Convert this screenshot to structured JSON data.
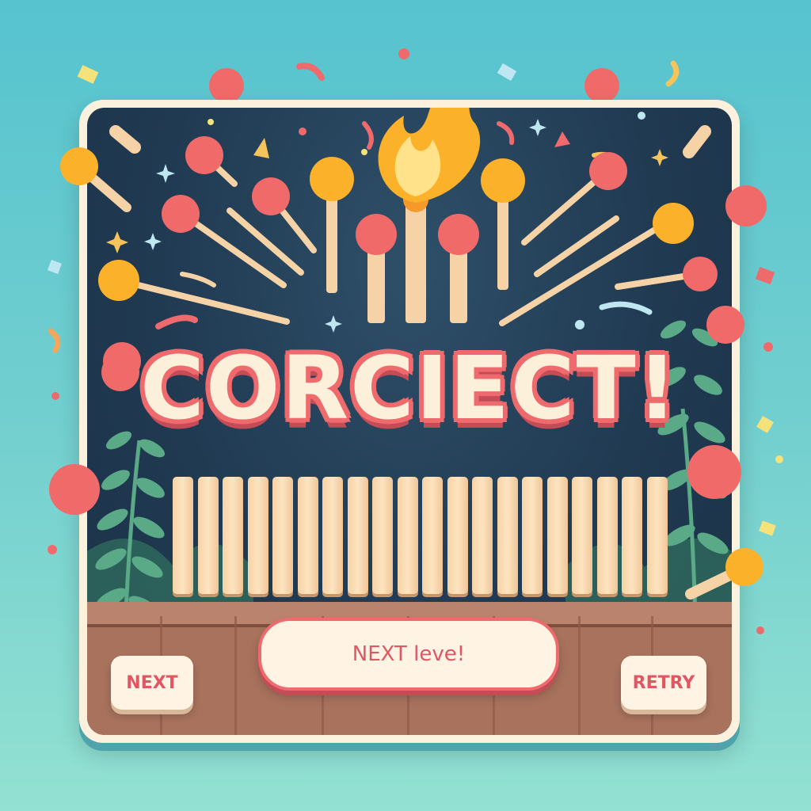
{
  "screen": {
    "headline": "CORCIECT!",
    "buttons": {
      "next_level_label": "NEXT leve!",
      "next_label": "NEXT",
      "retry_label": "RETRY"
    }
  },
  "colors": {
    "background": "#5cc4cf",
    "panel_frame": "#fbf1dc",
    "panel_dark": "#203a52",
    "headline_fill": "#fdf0db",
    "headline_outline": "#ef6a6d",
    "button_text": "#e05763",
    "match_stick": "#f6d3a6",
    "match_head_red": "#f06a6a",
    "match_head_orange": "#fbb12a",
    "wood_ground": "#a8725d",
    "leaves": "#5aa987"
  },
  "icons": {
    "flame": "flame-icon",
    "sparkle": "sparkle-icon",
    "match": "matchstick-icon",
    "leaf": "leaf-icon"
  },
  "level_result": {
    "answer_sticks": 20
  }
}
